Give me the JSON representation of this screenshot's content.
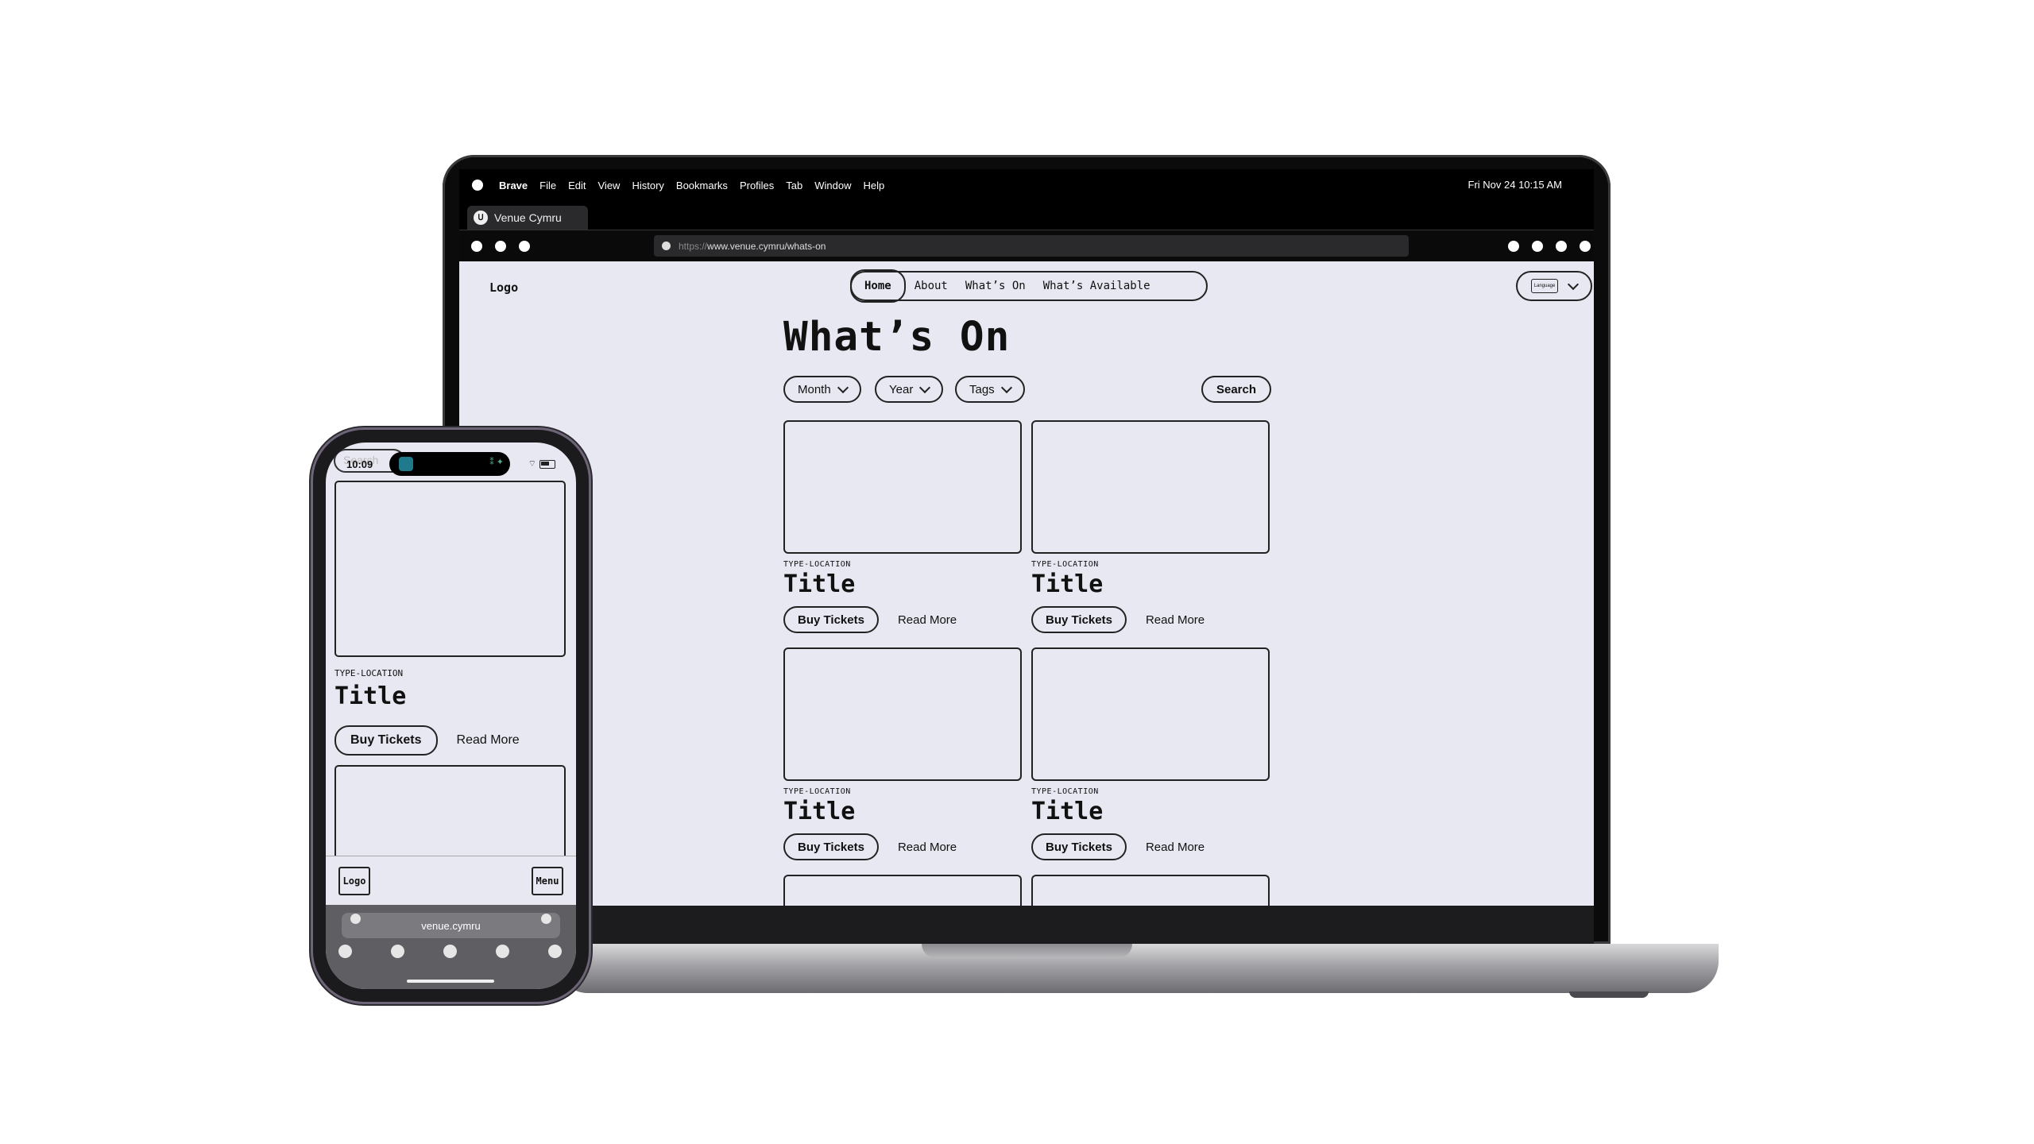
{
  "macos": {
    "menu_items": [
      "Brave",
      "File",
      "Edit",
      "View",
      "History",
      "Bookmarks",
      "Profiles",
      "Tab",
      "Window",
      "Help"
    ],
    "clock": "Fri Nov 24 10:15 AM"
  },
  "browser": {
    "tab_title": "Venue Cymru",
    "tab_icon_glyph": "ᑌ",
    "url_scheme": "https://",
    "url_rest": "www.venue.cymru/whats-on"
  },
  "site": {
    "logo": "Logo",
    "nav": [
      "Home",
      "About",
      "What’s On",
      "What’s Available"
    ],
    "language_label": "Language",
    "heading": "What’s On",
    "filters": [
      "Month",
      "Year",
      "Tags"
    ],
    "search_label": "Search",
    "cards": [
      {
        "type": "TYPE-LOCATION",
        "title": "Title",
        "buy": "Buy Tickets",
        "read": "Read More"
      },
      {
        "type": "TYPE-LOCATION",
        "title": "Title",
        "buy": "Buy Tickets",
        "read": "Read More"
      },
      {
        "type": "TYPE-LOCATION",
        "title": "Title",
        "buy": "Buy Tickets",
        "read": "Read More"
      },
      {
        "type": "TYPE-LOCATION",
        "title": "Title",
        "buy": "Buy Tickets",
        "read": "Read More"
      }
    ]
  },
  "phone": {
    "time": "10:09",
    "search_placeholder": "Search",
    "card": {
      "type": "TYPE-LOCATION",
      "title": "Title",
      "buy": "Buy Tickets",
      "read": "Read More"
    },
    "nav_logo": "Logo",
    "nav_menu": "Menu",
    "url": "venue.cymru"
  }
}
